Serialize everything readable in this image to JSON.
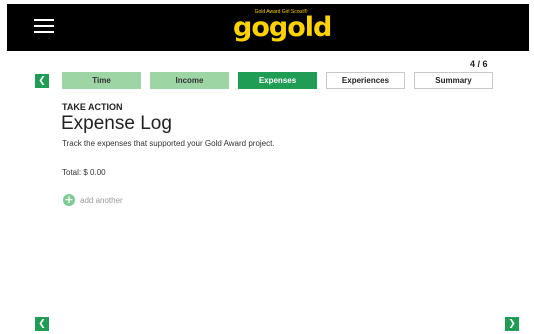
{
  "header": {
    "logo_tagline": "Gold Award Girl Scout®",
    "logo_go": "go",
    "logo_gold": "gold"
  },
  "progress": "4 / 6",
  "tabs": [
    {
      "label": "Time",
      "state": "done"
    },
    {
      "label": "Income",
      "state": "done"
    },
    {
      "label": "Expenses",
      "state": "active"
    },
    {
      "label": "Experiences",
      "state": "todo"
    },
    {
      "label": "Summary",
      "state": "todo"
    }
  ],
  "content": {
    "eyebrow": "TAKE ACTION",
    "title": "Expense Log",
    "description": "Track the expenses that supported your Gold Award project.",
    "total": "Total: $ 0.00",
    "add_label": "add another"
  },
  "icons": {
    "menu": "hamburger-menu-icon",
    "prev": "chevron-left-icon",
    "next": "chevron-right-icon",
    "add": "plus-circle-icon"
  },
  "colors": {
    "accent_green": "#1f9d55",
    "completed_tab": "#9dd5a5",
    "brand_yellow": "#fcd200",
    "header_bg": "#000000"
  }
}
